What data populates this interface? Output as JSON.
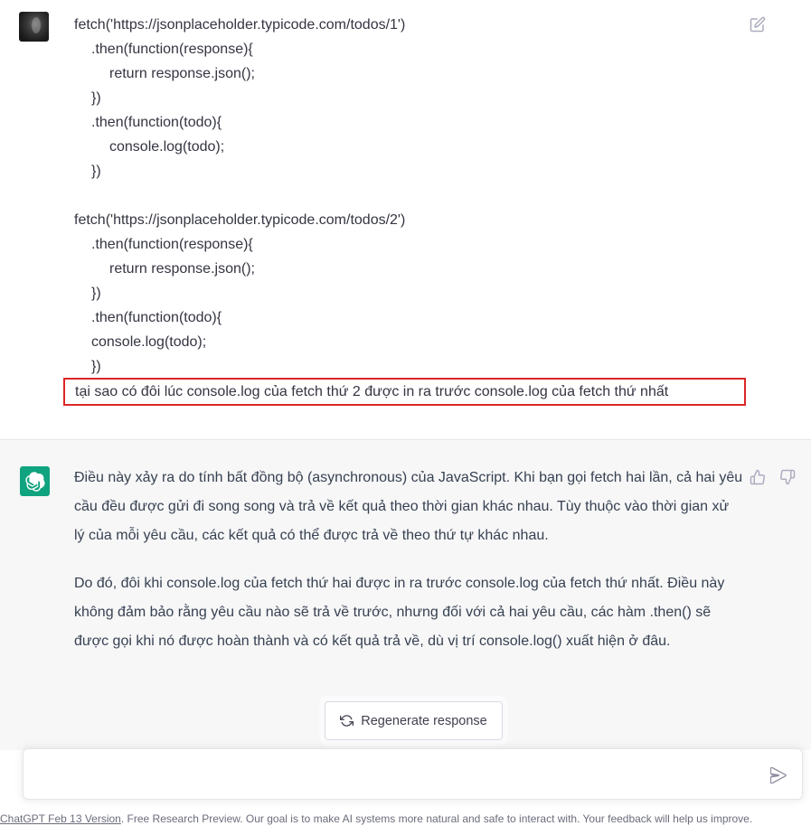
{
  "user_message": {
    "code_lines": [
      {
        "text": "fetch('https://jsonplaceholder.typicode.com/todos/1')",
        "indent": 0
      },
      {
        "text": ".then(function(response){",
        "indent": 1
      },
      {
        "text": "return response.json();",
        "indent": 2
      },
      {
        "text": "})",
        "indent": 1
      },
      {
        "text": ".then(function(todo){",
        "indent": 1
      },
      {
        "text": "console.log(todo);",
        "indent": 2
      },
      {
        "text": "})",
        "indent": 1
      },
      {
        "text": "",
        "indent": 0
      },
      {
        "text": "fetch('https://jsonplaceholder.typicode.com/todos/2')",
        "indent": 0
      },
      {
        "text": ".then(function(response){",
        "indent": 1
      },
      {
        "text": "return response.json();",
        "indent": 2
      },
      {
        "text": "})",
        "indent": 1
      },
      {
        "text": ".then(function(todo){",
        "indent": 1
      },
      {
        "text": "console.log(todo);",
        "indent": 1
      },
      {
        "text": "})",
        "indent": 1
      }
    ],
    "question": "tại sao có đôi lúc console.log của fetch thứ 2 được in ra trước console.log của fetch thứ nhất",
    "edit_icon": "edit-icon",
    "highlight_color": "#dc2626"
  },
  "assistant_message": {
    "paragraphs": [
      "Điều này xảy ra do tính bất đồng bộ (asynchronous) của JavaScript. Khi bạn gọi fetch hai lần, cả hai yêu cầu đều được gửi đi song song và trả về kết quả theo thời gian khác nhau. Tùy thuộc vào thời gian xử lý của mỗi yêu cầu, các kết quả có thể được trả về theo thứ tự khác nhau.",
      "Do đó, đôi khi console.log của fetch thứ hai được in ra trước console.log của fetch thứ nhất. Điều này không đảm bảo rằng yêu cầu nào sẽ trả về trước, nhưng đối với cả hai yêu cầu, các hàm .then() sẽ được gọi khi nó được hoàn thành và có kết quả trả về, dù vị trí console.log() xuất hiện ở đâu."
    ],
    "avatar_icon": "openai-logo-icon",
    "avatar_color": "#10a37f"
  },
  "regenerate": {
    "label": "Regenerate response",
    "icon": "refresh-icon"
  },
  "prompt": {
    "value": "",
    "placeholder": "",
    "send_icon": "send-icon"
  },
  "footer": {
    "version_link": "ChatGPT Feb 13 Version",
    "text": ". Free Research Preview. Our goal is to make AI systems more natural and safe to interact with. Your feedback will help us improve."
  }
}
